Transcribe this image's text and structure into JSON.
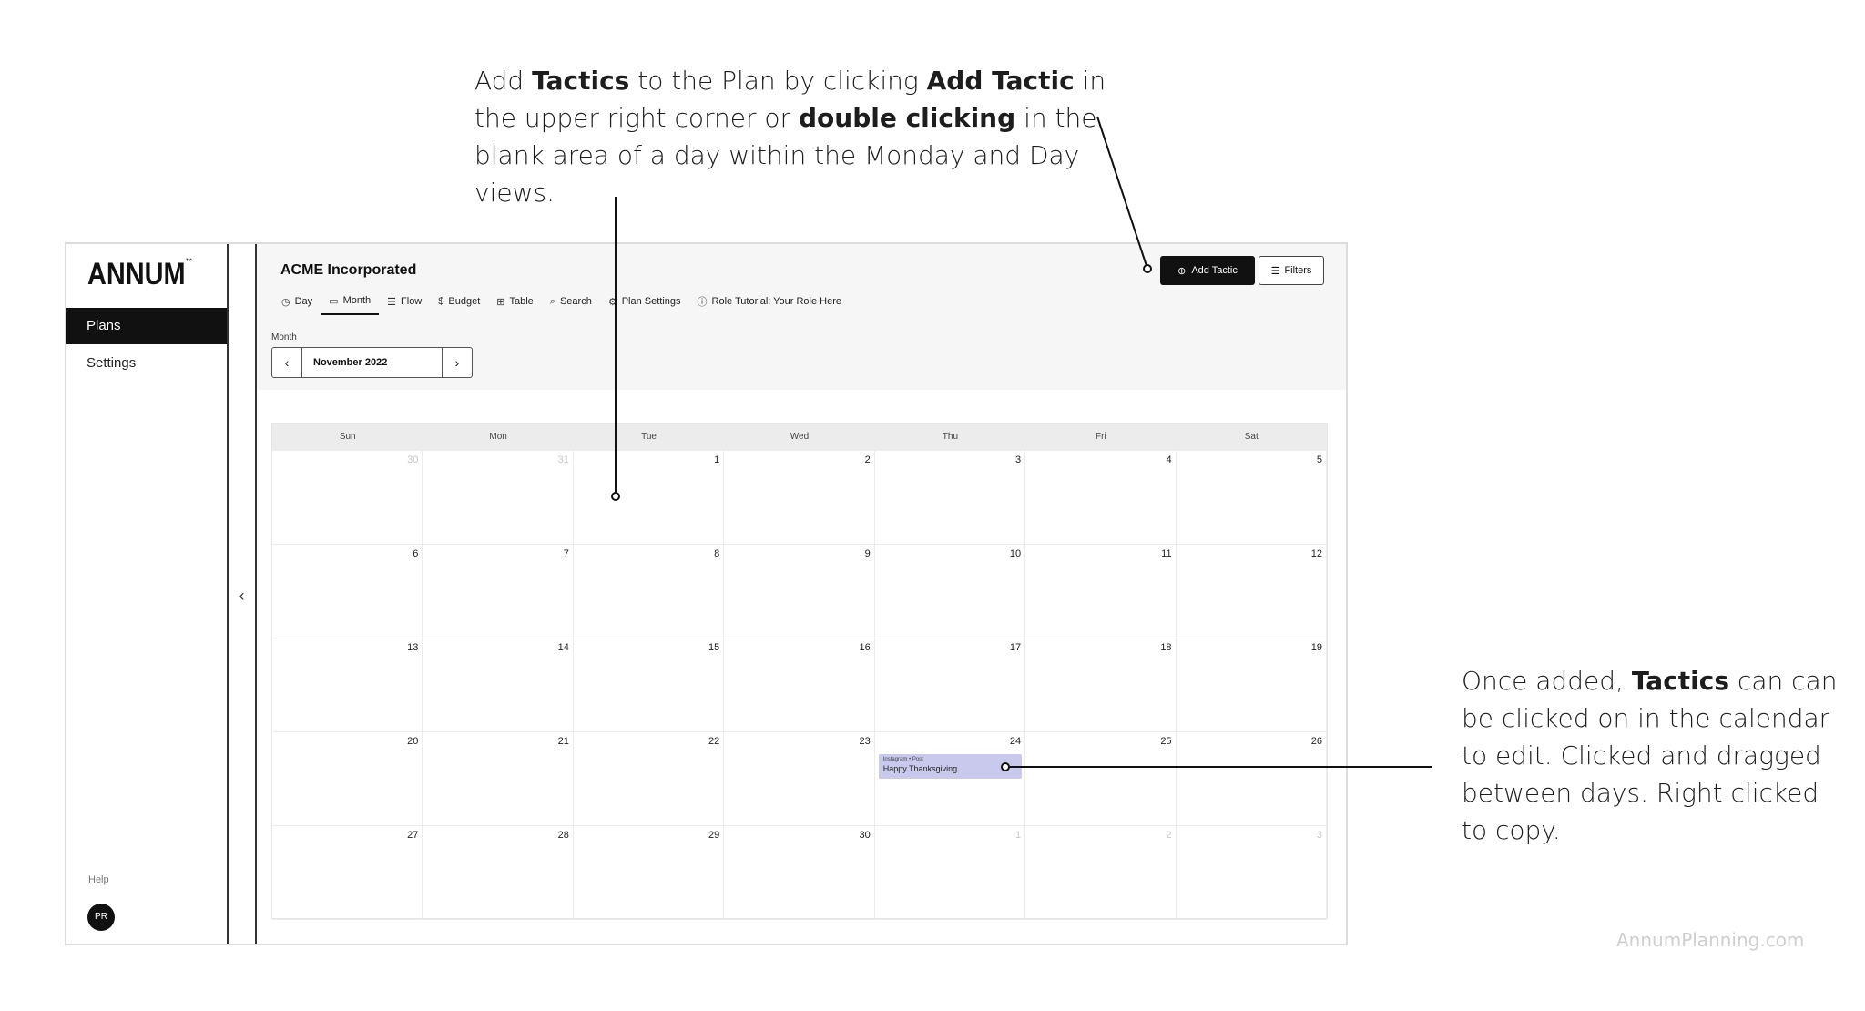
{
  "annotations": {
    "top": {
      "p1": "Add ",
      "b1": "Tactics",
      "p2": " to the Plan by clicking ",
      "b2": "Add Tactic",
      "p3": " in the upper right corner or ",
      "b3": "double clicking",
      "p4": " in the blank area of a day within the Monday and Day views."
    },
    "right": {
      "p1": "Once added, ",
      "b1": "Tactics",
      "p2": " can can be clicked on in the calendar to edit. Clicked and dragged between days. Right clicked to copy."
    },
    "watermark": "AnnumPlanning.com"
  },
  "sidebar": {
    "logo": "ANNUM",
    "logo_mark": "™",
    "items": [
      {
        "label": "Plans",
        "active": true
      },
      {
        "label": "Settings",
        "active": false
      }
    ],
    "help": "Help",
    "avatar_initials": "PR"
  },
  "header": {
    "org_title": "ACME Incorporated",
    "add_button": "Add Tactic",
    "filters_button": "Filters"
  },
  "tabs": [
    {
      "label": "Day",
      "icon": "clock-icon",
      "glyph": "◷"
    },
    {
      "label": "Month",
      "icon": "calendar-icon",
      "glyph": "▭",
      "active": true
    },
    {
      "label": "Flow",
      "icon": "flow-icon",
      "glyph": "☰"
    },
    {
      "label": "Budget",
      "icon": "dollar-icon",
      "glyph": "$"
    },
    {
      "label": "Table",
      "icon": "grid-icon",
      "glyph": "⊞"
    },
    {
      "label": "Search",
      "icon": "search-icon",
      "glyph": "⌕"
    },
    {
      "label": "Plan Settings",
      "icon": "gear-icon",
      "glyph": "⚙"
    },
    {
      "label": "Role Tutorial: Your Role Here",
      "icon": "info-icon",
      "glyph": "ⓘ"
    }
  ],
  "month_picker": {
    "label": "Month",
    "value": "November 2022"
  },
  "calendar": {
    "weekdays": [
      "Sun",
      "Mon",
      "Tue",
      "Wed",
      "Thu",
      "Fri",
      "Sat"
    ],
    "weeks": [
      [
        {
          "d": "30",
          "muted": true
        },
        {
          "d": "31",
          "muted": true
        },
        {
          "d": "1"
        },
        {
          "d": "2"
        },
        {
          "d": "3"
        },
        {
          "d": "4"
        },
        {
          "d": "5"
        }
      ],
      [
        {
          "d": "6"
        },
        {
          "d": "7"
        },
        {
          "d": "8"
        },
        {
          "d": "9"
        },
        {
          "d": "10"
        },
        {
          "d": "11"
        },
        {
          "d": "12"
        }
      ],
      [
        {
          "d": "13"
        },
        {
          "d": "14"
        },
        {
          "d": "15"
        },
        {
          "d": "16"
        },
        {
          "d": "17"
        },
        {
          "d": "18"
        },
        {
          "d": "19"
        }
      ],
      [
        {
          "d": "20"
        },
        {
          "d": "21"
        },
        {
          "d": "22"
        },
        {
          "d": "23"
        },
        {
          "d": "24",
          "event": {
            "meta": "Instagram • Post",
            "title": "Happy Thanksgiving"
          }
        },
        {
          "d": "25"
        },
        {
          "d": "26"
        }
      ],
      [
        {
          "d": "27"
        },
        {
          "d": "28"
        },
        {
          "d": "29"
        },
        {
          "d": "30"
        },
        {
          "d": "1",
          "muted": true
        },
        {
          "d": "2",
          "muted": true
        },
        {
          "d": "3",
          "muted": true
        }
      ]
    ]
  },
  "colors": {
    "event_bg": "#c8c9ec",
    "primary": "#111111"
  }
}
